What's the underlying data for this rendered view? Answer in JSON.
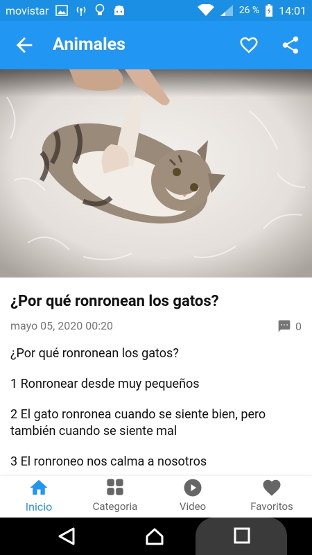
{
  "status_bar": {
    "carrier": "movistar",
    "battery": "26 %",
    "time": "14:01",
    "icons": [
      "image-icon",
      "signal-broadcast-icon",
      "bulb-icon",
      "android-icon",
      "wifi-icon",
      "cell-signal-icon",
      "battery-charging-icon"
    ]
  },
  "app_bar": {
    "title": "Animales",
    "back_icon": "arrow-back-icon",
    "favorite_icon": "heart-outline-icon",
    "share_icon": "share-icon",
    "color": "#2196f3"
  },
  "article": {
    "title": "¿Por qué ronronean los gatos?",
    "date": "mayo 05, 2020 00:20",
    "comment_count": "0",
    "paragraphs": [
      "¿Por qué ronronean los gatos?",
      "1 Ronronear desde muy pequeños",
      "2 El gato ronronea cuando se siente bien, pero también cuando se siente mal",
      "3 El ronroneo nos calma a nosotros"
    ]
  },
  "bottom_nav": {
    "items": [
      {
        "label": "Inicio",
        "icon": "home-icon",
        "active": true
      },
      {
        "label": "Categoria",
        "icon": "grid-icon",
        "active": false
      },
      {
        "label": "Video",
        "icon": "play-circle-icon",
        "active": false
      },
      {
        "label": "Favoritos",
        "icon": "heart-icon",
        "active": false
      }
    ],
    "active_color": "#2196f3"
  },
  "system_nav": {
    "icons": [
      "back-triangle-icon",
      "home-circle-icon",
      "recents-square-icon"
    ]
  }
}
